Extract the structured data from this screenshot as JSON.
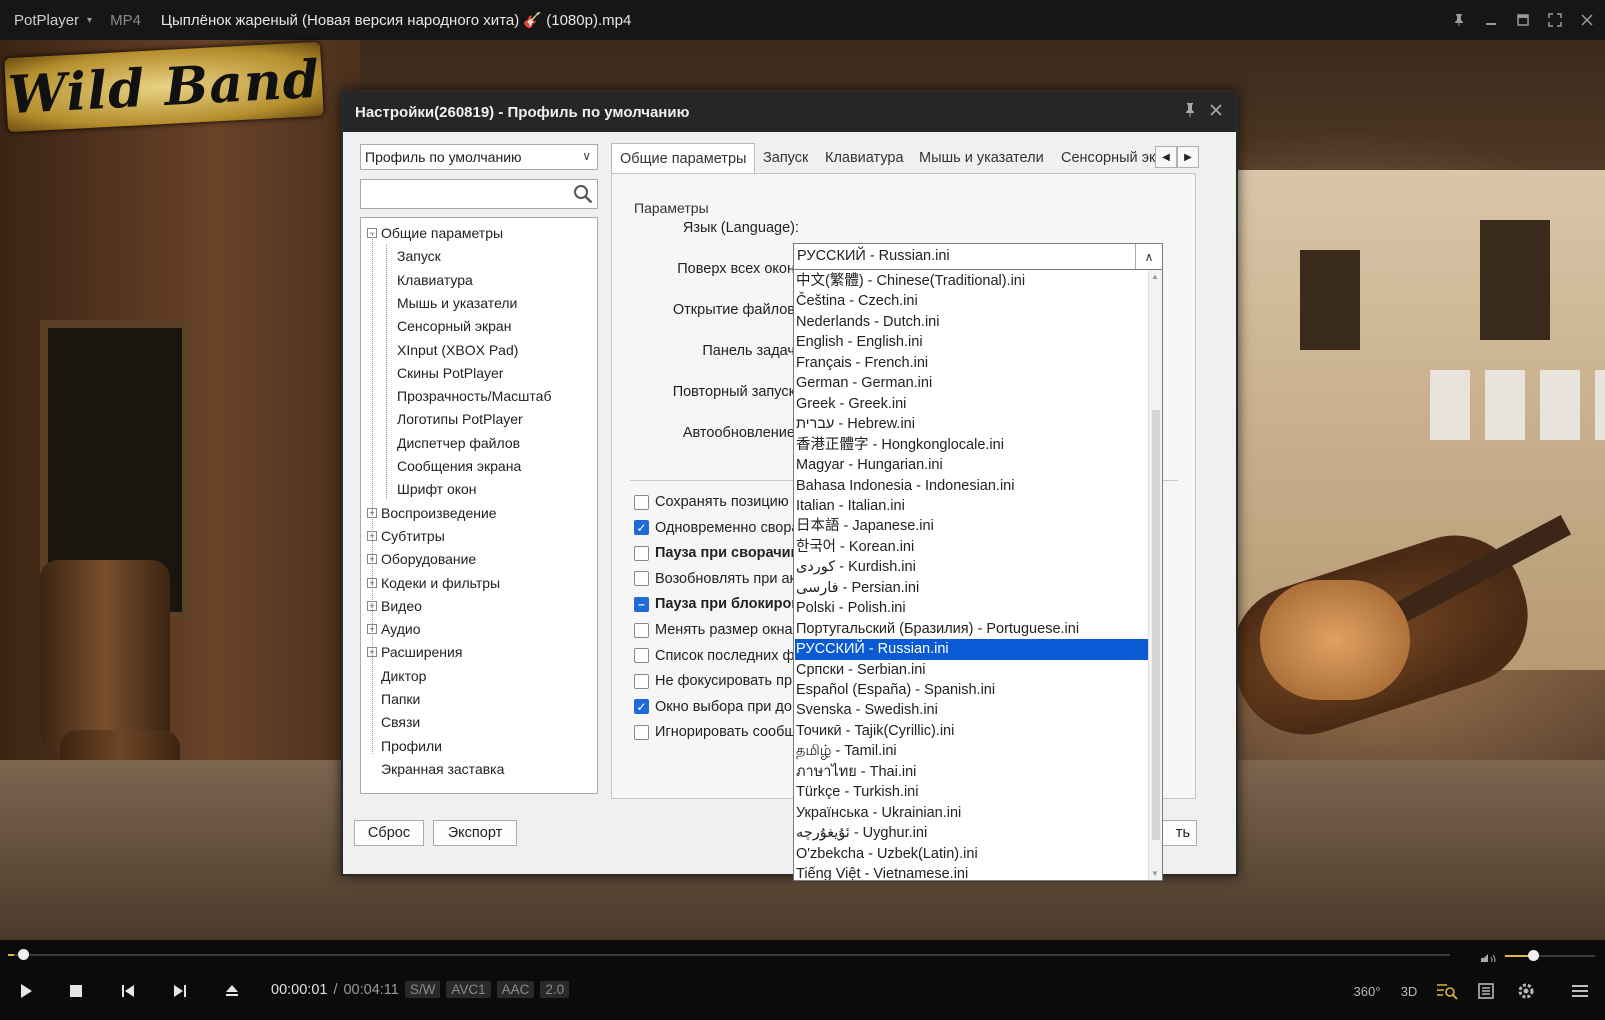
{
  "titlebar": {
    "app_name": "PotPlayer",
    "format": "MP4",
    "file_title": "Цыплёнок жареный (Новая версия народного хита) 🎸 (1080p).mp4"
  },
  "video": {
    "logo_text": "Wild Band"
  },
  "dialog": {
    "title": "Настройки(260819) - Профиль по умолчанию",
    "profile_combo": "Профиль по умолчанию",
    "search_placeholder": "",
    "tree": [
      {
        "label": "Общие параметры",
        "expander": "−",
        "level": 0
      },
      {
        "label": "Запуск",
        "level": 1
      },
      {
        "label": "Клавиатура",
        "level": 1
      },
      {
        "label": "Мышь и указатели",
        "level": 1
      },
      {
        "label": "Сенсорный экран",
        "level": 1
      },
      {
        "label": "XInput (XBOX Pad)",
        "level": 1
      },
      {
        "label": "Скины PotPlayer",
        "level": 1
      },
      {
        "label": "Прозрачность/Масштаб",
        "level": 1
      },
      {
        "label": "Логотипы PotPlayer",
        "level": 1
      },
      {
        "label": "Диспетчер файлов",
        "level": 1
      },
      {
        "label": "Сообщения экрана",
        "level": 1
      },
      {
        "label": "Шрифт окон",
        "level": 1
      },
      {
        "label": "Воспроизведение",
        "expander": "+",
        "level": 0
      },
      {
        "label": "Субтитры",
        "expander": "+",
        "level": 0
      },
      {
        "label": "Оборудование",
        "expander": "+",
        "level": 0
      },
      {
        "label": "Кодеки и фильтры",
        "expander": "+",
        "level": 0
      },
      {
        "label": "Видео",
        "expander": "+",
        "level": 0
      },
      {
        "label": "Аудио",
        "expander": "+",
        "level": 0
      },
      {
        "label": "Расширения",
        "expander": "+",
        "level": 0
      },
      {
        "label": "Диктор",
        "level": 0
      },
      {
        "label": "Папки",
        "level": 0
      },
      {
        "label": "Связи",
        "level": 0
      },
      {
        "label": "Профили",
        "level": 0
      },
      {
        "label": "Экранная заставка",
        "level": 0
      }
    ],
    "tabs": [
      {
        "label": "Общие параметры",
        "active": true
      },
      {
        "label": "Запуск"
      },
      {
        "label": "Клавиатура"
      },
      {
        "label": "Мышь и указатели"
      },
      {
        "label": "Сенсорный эк"
      }
    ],
    "group_title": "Параметры",
    "labels": {
      "language": "Язык (Language):",
      "on_top": "Поверх всех окон:",
      "open_files": "Открытие файлов:",
      "taskbar": "Панель задач:",
      "restart": "Повторный запуск:",
      "autoupdate": "Автообновление:"
    },
    "checkboxes": [
      {
        "label": "Сохранять позицию п",
        "state": "off",
        "bold": false
      },
      {
        "label": "Одновременно свора",
        "state": "on",
        "bold": false
      },
      {
        "label": "Пауза при сворачив",
        "state": "off",
        "bold": true
      },
      {
        "label": "Возобновлять при ак",
        "state": "off",
        "bold": false
      },
      {
        "label": "Пауза при блокиров",
        "state": "mixed",
        "bold": true
      },
      {
        "label": "Менять размер окна",
        "state": "off",
        "bold": false
      },
      {
        "label": "Список последних фа",
        "state": "off",
        "bold": false
      },
      {
        "label": "Не фокусировать при",
        "state": "off",
        "bold": false
      },
      {
        "label": "Окно выбора при до",
        "state": "on",
        "bold": false
      },
      {
        "label": "Игнорировать сообщ",
        "state": "off",
        "bold": false
      }
    ],
    "language_value": "РУССКИЙ - Russian.ini",
    "language_options": [
      "中文(繁體) - Chinese(Traditional).ini",
      "Čeština - Czech.ini",
      "Nederlands - Dutch.ini",
      "English - English.ini",
      "Français - French.ini",
      "German - German.ini",
      "Greek - Greek.ini",
      "עברית - Hebrew.ini",
      "香港正體字 - Hongkonglocale.ini",
      "Magyar - Hungarian.ini",
      "Bahasa Indonesia - Indonesian.ini",
      "Italian - Italian.ini",
      "日本語 - Japanese.ini",
      "한국어 - Korean.ini",
      "کوردی - Kurdish.ini",
      "فارسی - Persian.ini",
      "Polski - Polish.ini",
      "Португальский (Бразилия) - Portuguese.ini",
      "РУССКИЙ - Russian.ini",
      "Српски - Serbian.ini",
      "Español (España) - Spanish.ini",
      "Svenska - Swedish.ini",
      "Точикӣ - Tajik(Cyrillic).ini",
      "தமிழ் - Tamil.ini",
      "ภาษาไทย - Thai.ini",
      "Türkçe - Turkish.ini",
      "Українська - Ukrainian.ini",
      "ئۇيغۇرچە - Uyghur.ini",
      "O'zbekcha - Uzbek(Latin).ini",
      "Tiếng Việt - Vietnamese.ini"
    ],
    "selected_language_index": 18,
    "buttons": {
      "reset": "Сброс",
      "export": "Экспорт",
      "apply_partial": "ть"
    }
  },
  "player": {
    "time_current": "00:00:01",
    "time_sep": "/",
    "time_total": "00:04:11",
    "tags": [
      "S/W",
      "AVC1",
      "AAC",
      "2.0"
    ],
    "right_icons": [
      "360°",
      "3D"
    ],
    "seek_progress": 0.004,
    "volume_level": 0.28,
    "accent_color": "#e2b63a"
  }
}
